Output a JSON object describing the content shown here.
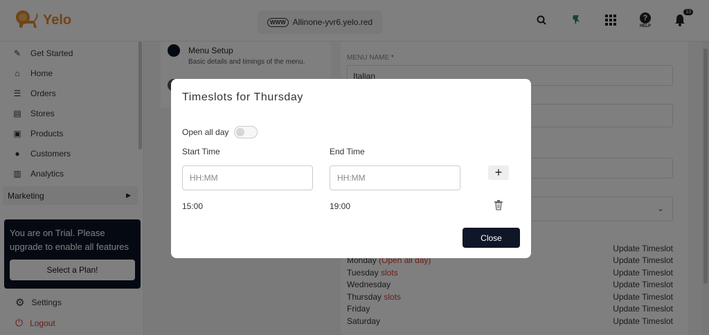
{
  "app": {
    "name": "Yelo",
    "url": "Allinone-yvr6.yelo.red"
  },
  "header": {
    "icons": [
      "search-icon",
      "lead-icon",
      "apps-grid-icon",
      "help-icon",
      "bell-icon"
    ],
    "help_label": "HELP",
    "notification_count": "13"
  },
  "sidebar": {
    "items": [
      {
        "label": "Get Started",
        "icon": "get-started-icon"
      },
      {
        "label": "Home",
        "icon": "home-icon"
      },
      {
        "label": "Orders",
        "icon": "orders-icon"
      },
      {
        "label": "Stores",
        "icon": "stores-icon"
      },
      {
        "label": "Products",
        "icon": "products-icon"
      },
      {
        "label": "Customers",
        "icon": "customers-icon"
      },
      {
        "label": "Analytics",
        "icon": "analytics-icon"
      }
    ],
    "marketing_label": "Marketing",
    "trial_text": "You are on Trial. Please upgrade to enable all features",
    "trial_button": "Select a Plan!",
    "settings_label": "Settings",
    "logout_label": "Logout"
  },
  "steps": {
    "title": "Menu Setup",
    "description": "Basic details and timings of the menu."
  },
  "form": {
    "menu_name_label": "MENU NAME",
    "required_mark": "*",
    "menu_name_value": "Italian",
    "update_label": "Update Timeslot",
    "days": [
      {
        "name": "Monday",
        "note": "(Open all day)"
      },
      {
        "name": "Tuesday",
        "note": "slots"
      },
      {
        "name": "Wednesday",
        "note": ""
      },
      {
        "name": "Thursday",
        "note": "slots"
      },
      {
        "name": "Friday",
        "note": ""
      },
      {
        "name": "Saturday",
        "note": ""
      }
    ]
  },
  "modal": {
    "title": "Timeslots for Thursday",
    "open_all_day_label": "Open all day",
    "open_all_day": false,
    "start_label": "Start Time",
    "end_label": "End Time",
    "start_placeholder": "HH:MM",
    "end_placeholder": "HH:MM",
    "add_label": "+",
    "slots": [
      {
        "start": "15:00",
        "end": "19:00"
      }
    ],
    "close_label": "Close"
  },
  "colors": {
    "brand": "#e08b2e",
    "dark": "#0e1628",
    "danger": "#d23b2b"
  }
}
